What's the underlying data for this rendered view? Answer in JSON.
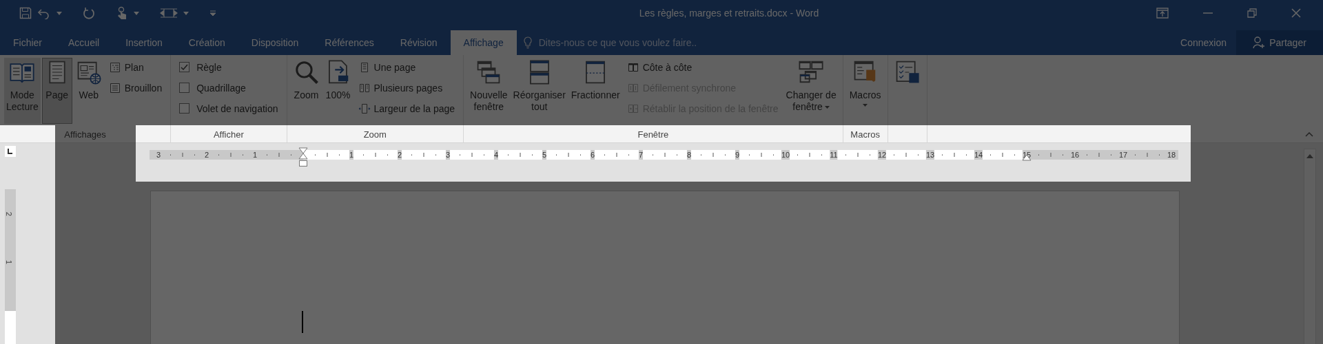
{
  "window": {
    "title": "Les règles, marges et retraits.docx - Word"
  },
  "tabs": [
    {
      "label": "Fichier",
      "selected": false
    },
    {
      "label": "Accueil",
      "selected": false
    },
    {
      "label": "Insertion",
      "selected": false
    },
    {
      "label": "Création",
      "selected": false
    },
    {
      "label": "Disposition",
      "selected": false
    },
    {
      "label": "Références",
      "selected": false
    },
    {
      "label": "Révision",
      "selected": false
    },
    {
      "label": "Affichage",
      "selected": true
    }
  ],
  "tell_me": {
    "placeholder": "Dites-nous ce que vous voulez faire.."
  },
  "account": {
    "sign_in": "Connexion",
    "share": "Partager"
  },
  "ribbon": {
    "groups": [
      {
        "label": "Affichages",
        "controls": [
          {
            "kind": "large",
            "lines": [
              "Mode",
              "Lecture"
            ],
            "selected": false,
            "hovered": true
          },
          {
            "kind": "large",
            "lines": [
              "Page"
            ],
            "selected": true,
            "hovered": false
          },
          {
            "kind": "large",
            "lines": [
              "Web"
            ],
            "selected": false,
            "hovered": false
          },
          {
            "kind": "stack",
            "items": [
              {
                "kind": "small",
                "label": "Plan",
                "disabled": false
              },
              {
                "kind": "small",
                "label": "Brouillon",
                "disabled": false
              }
            ]
          }
        ]
      },
      {
        "label": "Afficher",
        "controls": [
          {
            "kind": "stack",
            "items": [
              {
                "kind": "checkbox",
                "label": "Règle",
                "checked": true
              },
              {
                "kind": "checkbox",
                "label": "Quadrillage",
                "checked": false
              },
              {
                "kind": "checkbox",
                "label": "Volet de navigation",
                "checked": false
              }
            ]
          }
        ]
      },
      {
        "label": "Zoom",
        "controls": [
          {
            "kind": "large",
            "lines": [
              "Zoom"
            ],
            "selected": false,
            "hovered": false
          },
          {
            "kind": "large",
            "lines": [
              "100%"
            ],
            "selected": false,
            "hovered": false
          },
          {
            "kind": "stack",
            "items": [
              {
                "kind": "small",
                "label": "Une page",
                "disabled": false
              },
              {
                "kind": "small",
                "label": "Plusieurs pages",
                "disabled": false
              },
              {
                "kind": "small",
                "label": "Largeur de la page",
                "disabled": false
              }
            ]
          }
        ]
      },
      {
        "label": "Fenêtre",
        "controls": [
          {
            "kind": "large",
            "lines": [
              "Nouvelle",
              "fenêtre"
            ],
            "selected": false,
            "hovered": false
          },
          {
            "kind": "large",
            "lines": [
              "Réorganiser",
              "tout"
            ],
            "selected": false,
            "hovered": false
          },
          {
            "kind": "large",
            "lines": [
              "Fractionner"
            ],
            "selected": false,
            "hovered": false
          },
          {
            "kind": "stack",
            "items": [
              {
                "kind": "small",
                "label": "Côte à côte",
                "disabled": false
              },
              {
                "kind": "small",
                "label": "Défilement synchrone",
                "disabled": true
              },
              {
                "kind": "small",
                "label": "Rétablir la position de la fenêtre",
                "disabled": true
              }
            ]
          },
          {
            "kind": "large",
            "lines": [
              "Changer de",
              "fenêtre"
            ],
            "selected": false,
            "hovered": false,
            "dropdown": true
          }
        ]
      },
      {
        "label": "Macros",
        "controls": [
          {
            "kind": "large",
            "lines": [
              "Macros"
            ],
            "selected": false,
            "hovered": false,
            "dropdown": true
          }
        ]
      },
      {
        "controls": [
          {
            "kind": "large",
            "selected": false,
            "hovered": false
          }
        ]
      }
    ]
  },
  "ruler": {
    "left_numbers": [
      "3",
      "2",
      "1"
    ],
    "numbers": [
      "1",
      "2",
      "3",
      "4",
      "5",
      "6",
      "7",
      "8",
      "9",
      "10",
      "11",
      "12",
      "13",
      "14",
      "15",
      "16",
      "17",
      "18"
    ]
  },
  "vertical_ruler": {
    "numbers": [
      "2",
      "1"
    ]
  }
}
